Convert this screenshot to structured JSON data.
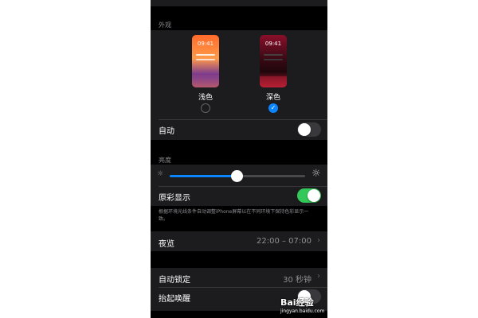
{
  "top_partial": "",
  "appearance": {
    "section_label": "外观",
    "light": {
      "time": "09:41",
      "label": "浅色",
      "selected": false
    },
    "dark": {
      "time": "09:41",
      "label": "深色",
      "selected": true
    },
    "auto_label": "自动",
    "auto_on": false
  },
  "brightness": {
    "section_label": "亮度",
    "level": 0.5,
    "true_tone_label": "原彩显示",
    "true_tone_on": true,
    "footer": "根据环境光线条件自动调整iPhone屏幕以在不同环境下保持色彩显示一致。"
  },
  "night_shift": {
    "label": "夜览",
    "value": "22:00 – 07:00"
  },
  "auto_lock": {
    "label": "自动锁定",
    "value": "30 秒钟"
  },
  "raise_to_wake": {
    "label": "抬起唤醒",
    "on": false
  },
  "watermark": {
    "text": "Bai经验",
    "subtext": "jingyan.baidu.com"
  },
  "colors": {
    "accent": "#0a84ff",
    "toggle_on": "#34c759",
    "toggle_off": "#39393d",
    "group_bg": "#1c1c1e",
    "separator": "#38383a"
  }
}
